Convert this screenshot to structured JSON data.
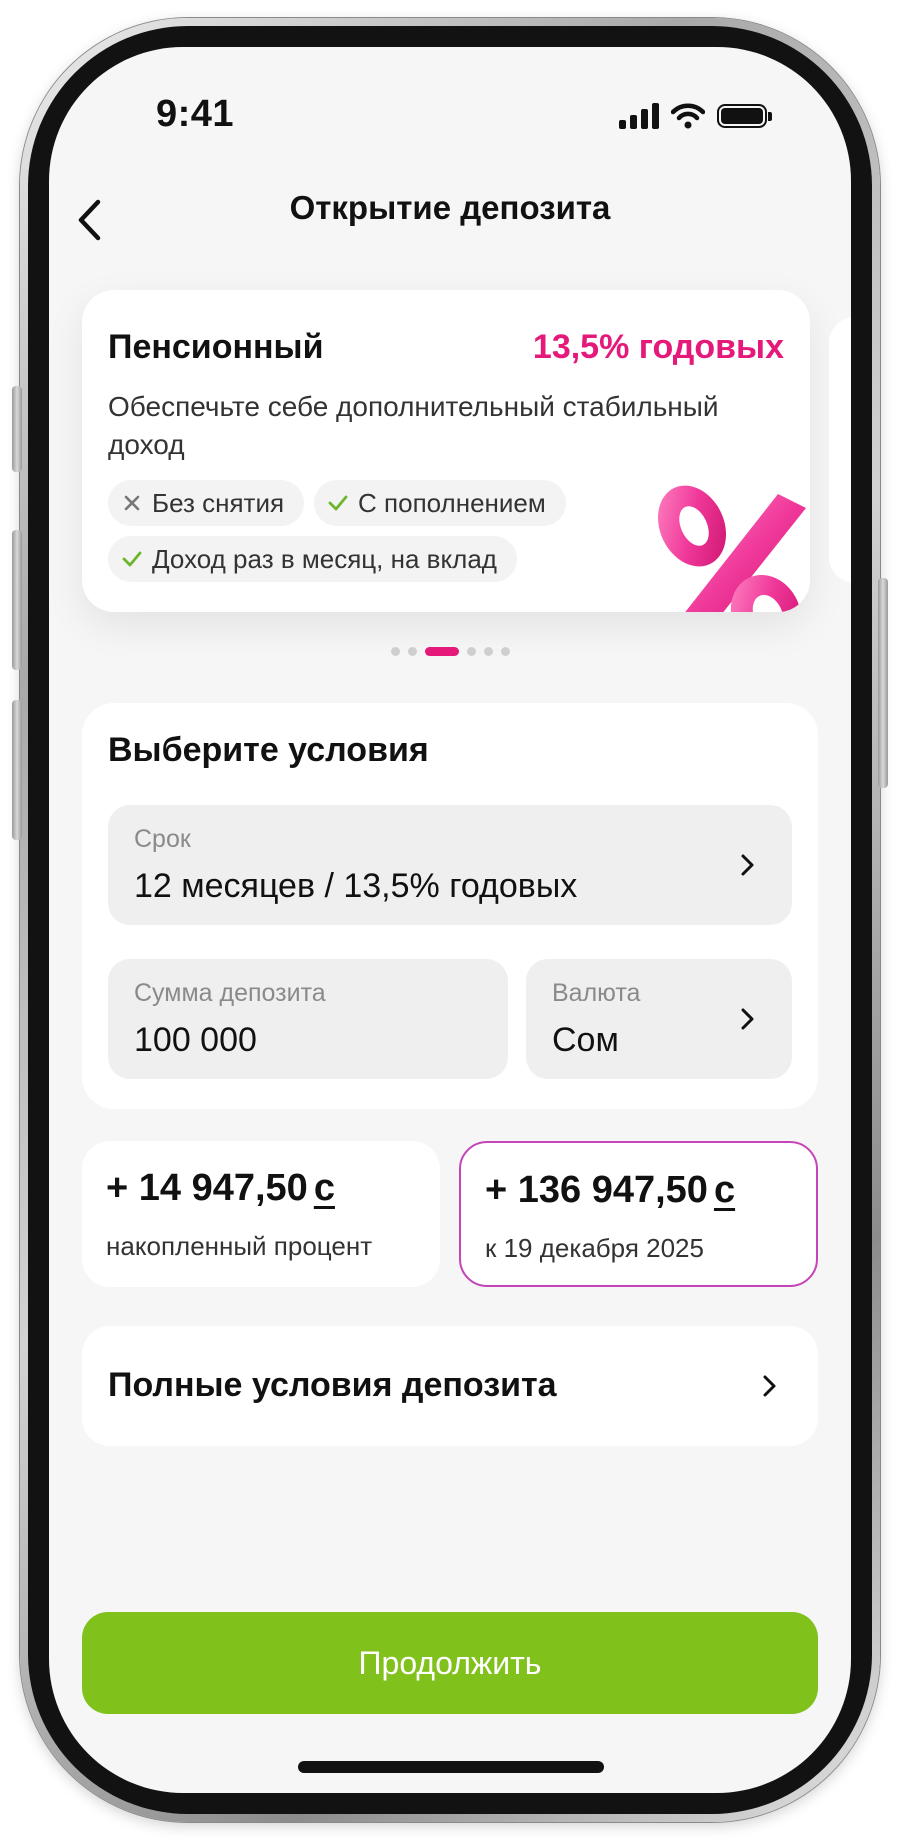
{
  "status_bar": {
    "time": "9:41"
  },
  "header": {
    "title": "Открытие депозита"
  },
  "product": {
    "name": "Пенсионный",
    "rate": "13,5% годовых",
    "description": "Обеспечьте себе дополнительный стабильный доход",
    "tags": [
      {
        "label": "Без снятия",
        "icon": "cross-icon"
      },
      {
        "label": "С пополнением",
        "icon": "check-icon"
      },
      {
        "label": "Доход раз в месяц, на вклад",
        "icon": "check-icon"
      }
    ],
    "illustration": "percent-icon"
  },
  "carousel": {
    "total": 6,
    "active_index": 2
  },
  "conditions": {
    "title": "Выберите условия",
    "term": {
      "label": "Срок",
      "value": "12 месяцев / 13,5% годовых"
    },
    "amount": {
      "label": "Сумма депозита",
      "value": "100 000"
    },
    "currency": {
      "label": "Валюта",
      "value": "Сом"
    }
  },
  "summary": {
    "accrued": {
      "amount": "+ 14 947,50",
      "currency": "с",
      "caption": "накопленный процент"
    },
    "total": {
      "amount": "+ 136 947,50",
      "currency": "с",
      "caption": "к 19 декабря 2025"
    }
  },
  "full_conditions": {
    "label": "Полные условия депозита"
  },
  "continue_button": {
    "label": "Продолжить"
  },
  "colors": {
    "accent_pink": "#e5197a",
    "primary_green": "#80c11c",
    "highlight_border": "#c445b8",
    "check_green": "#6cb52d"
  }
}
